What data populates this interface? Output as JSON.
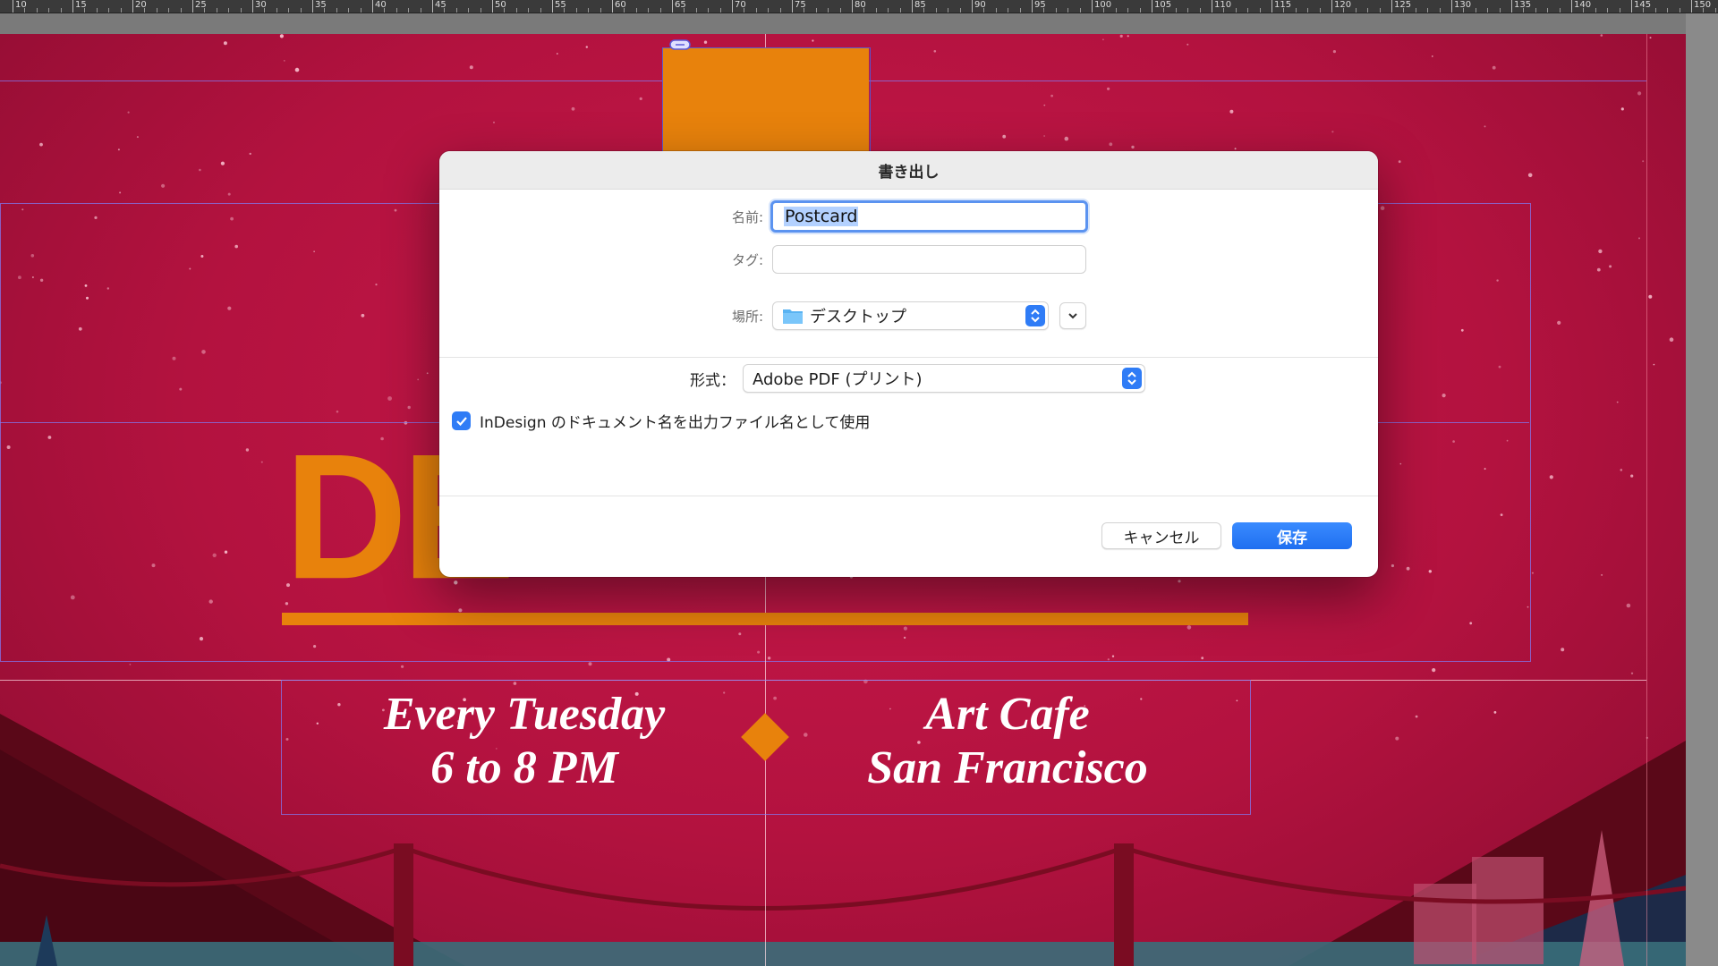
{
  "ruler": {
    "labels": [
      "10",
      "15",
      "20",
      "25",
      "30",
      "35",
      "40",
      "45",
      "50",
      "55",
      "60",
      "65",
      "70",
      "75",
      "80",
      "85",
      "90",
      "95",
      "100",
      "105",
      "110",
      "115",
      "120",
      "125",
      "130",
      "135",
      "140",
      "145",
      "150"
    ]
  },
  "artwork": {
    "headline": "DE",
    "event_left_line1": "Every Tuesday",
    "event_left_line2": "6 to 8 PM",
    "event_right_line1": "Art Cafe",
    "event_right_line2": "San Francisco",
    "colors": {
      "background": "#b3123f",
      "accent": "#e8820c"
    }
  },
  "dialog": {
    "title": "書き出し",
    "name_label": "名前:",
    "name_value": "Postcard",
    "tags_label": "タグ:",
    "tags_value": "",
    "location_label": "場所:",
    "location_value": "デスクトップ",
    "location_icon": "folder-icon",
    "format_label": "形式：",
    "format_value": "Adobe PDF (プリント)",
    "checkbox_checked": true,
    "checkbox_label": "InDesign のドキュメント名を出力ファイル名として使用",
    "cancel_label": "キャンセル",
    "save_label": "保存",
    "accent_color": "#2f7cf6"
  }
}
